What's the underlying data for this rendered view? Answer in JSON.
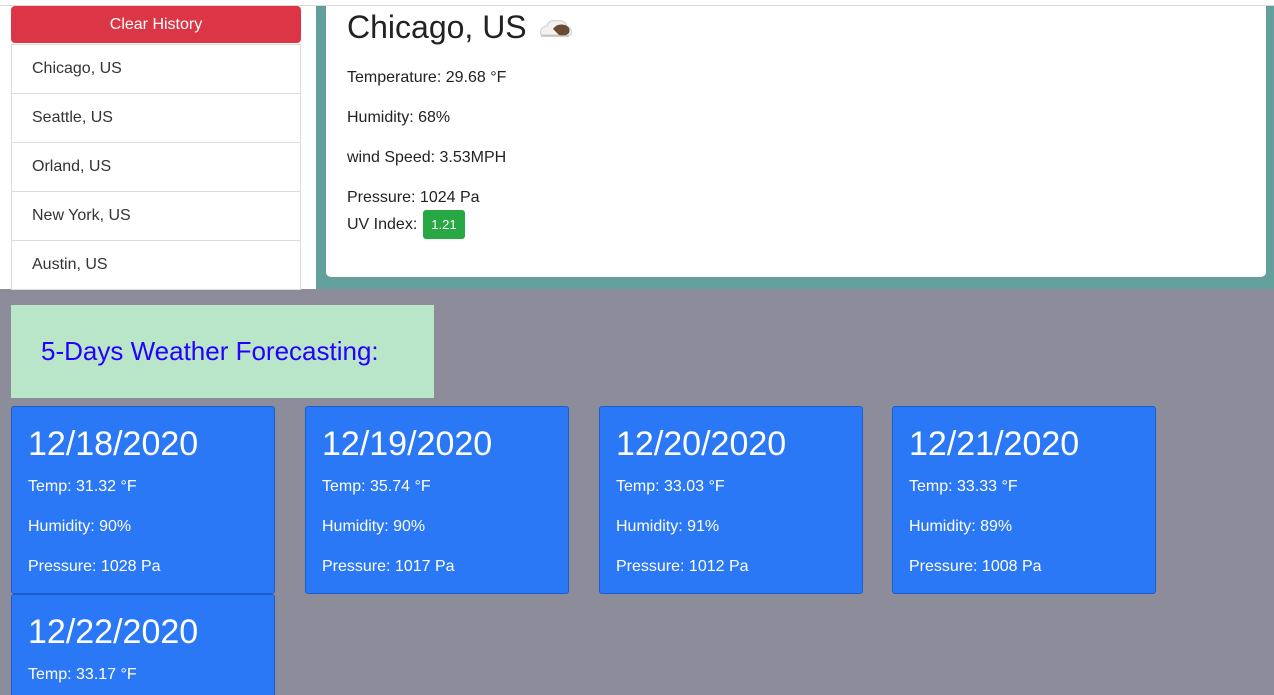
{
  "sidebar": {
    "clear_label": "Clear History",
    "history": [
      {
        "label": "Chicago, US"
      },
      {
        "label": "Seattle, US"
      },
      {
        "label": "Orland, US"
      },
      {
        "label": "New York, US"
      },
      {
        "label": "Austin, US"
      }
    ]
  },
  "current": {
    "city": "Chicago, US",
    "icon": "cloud-sun-icon",
    "temperature": "Temperature: 29.68 °F",
    "humidity": "Humidity: 68%",
    "wind": "wind Speed: 3.53MPH",
    "pressure": "Pressure: 1024 Pa",
    "uv_label": "UV Index:",
    "uv_value": "1.21"
  },
  "forecast": {
    "heading": "5-Days Weather Forecasting:",
    "days": [
      {
        "date": "12/18/2020",
        "temp": "Temp: 31.32 °F",
        "humidity": "Humidity: 90%",
        "pressure": "Pressure: 1028 Pa"
      },
      {
        "date": "12/19/2020",
        "temp": "Temp: 35.74 °F",
        "humidity": "Humidity: 90%",
        "pressure": "Pressure: 1017 Pa"
      },
      {
        "date": "12/20/2020",
        "temp": "Temp: 33.03 °F",
        "humidity": "Humidity: 91%",
        "pressure": "Pressure: 1012 Pa"
      },
      {
        "date": "12/21/2020",
        "temp": "Temp: 33.33 °F",
        "humidity": "Humidity: 89%",
        "pressure": "Pressure: 1008 Pa"
      },
      {
        "date": "12/22/2020",
        "temp": "Temp: 33.17 °F",
        "humidity": "",
        "pressure": ""
      }
    ]
  },
  "colors": {
    "clear_button": "#dc3545",
    "teal_panel": "#63a09b",
    "uv_badge": "#28a745",
    "forecast_card": "#2b78f7",
    "forecast_heading_bg": "#b9e5c8",
    "forecast_heading_text": "#2400ff",
    "page_bg": "#8d8c9b"
  }
}
